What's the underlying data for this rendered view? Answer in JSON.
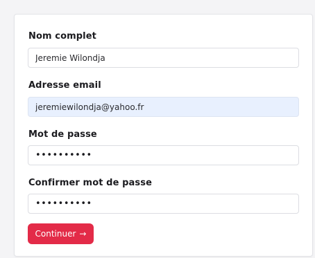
{
  "form": {
    "full_name": {
      "label": "Nom complet",
      "value": "Jeremie Wilondja"
    },
    "email": {
      "label": "Adresse email",
      "value": "jeremiewilondja@yahoo.fr"
    },
    "password": {
      "label": "Mot de passe",
      "value": "••••••••••"
    },
    "confirm_password": {
      "label": "Confirmer mot de passe",
      "value": "••••••••••"
    },
    "submit_label": "Continuer",
    "submit_icon": "arrow-right-icon",
    "accent_color": "#e32b48",
    "autofill_color": "#e8f0fe"
  }
}
